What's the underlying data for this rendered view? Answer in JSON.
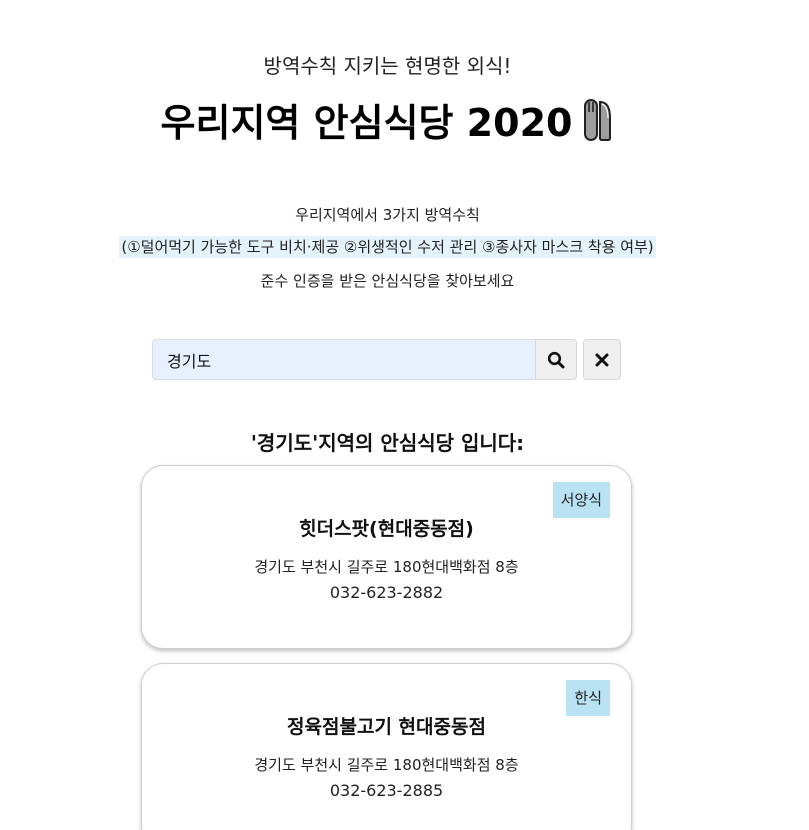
{
  "header": {
    "subtitle": "방역수칙 지키는 현명한 외식!",
    "title": "우리지역 안심식당 2020",
    "title_icon": "fork-knife-icon"
  },
  "intro": {
    "line1": "우리지역에서 3가지 방역수칙",
    "line2": "(①덜어먹기 가능한 도구 비치·제공 ②위생적인 수저 관리 ③종사자 마스크 착용 여부)",
    "line3": "준수 인증을 받은 안심식당을 찾아보세요"
  },
  "search": {
    "value": "경기도",
    "search_icon": "search-icon",
    "clear_icon": "close-icon"
  },
  "results": {
    "heading": "'경기도'지역의 안심식당 입니다:",
    "items": [
      {
        "category": "서양식",
        "name": "힛더스팟(현대중동점)",
        "address": "경기도 부천시 길주로 180현대백화점 8층",
        "phone": "032-623-2882"
      },
      {
        "category": "한식",
        "name": "정육점불고기 현대중동점",
        "address": "경기도 부천시 길주로 180현대백화점 8층",
        "phone": "032-623-2885"
      }
    ]
  },
  "colors": {
    "badge_bg": "#b9e2f3",
    "highlight_bg": "#e3f2fb",
    "input_bg": "#e8f0fe"
  }
}
